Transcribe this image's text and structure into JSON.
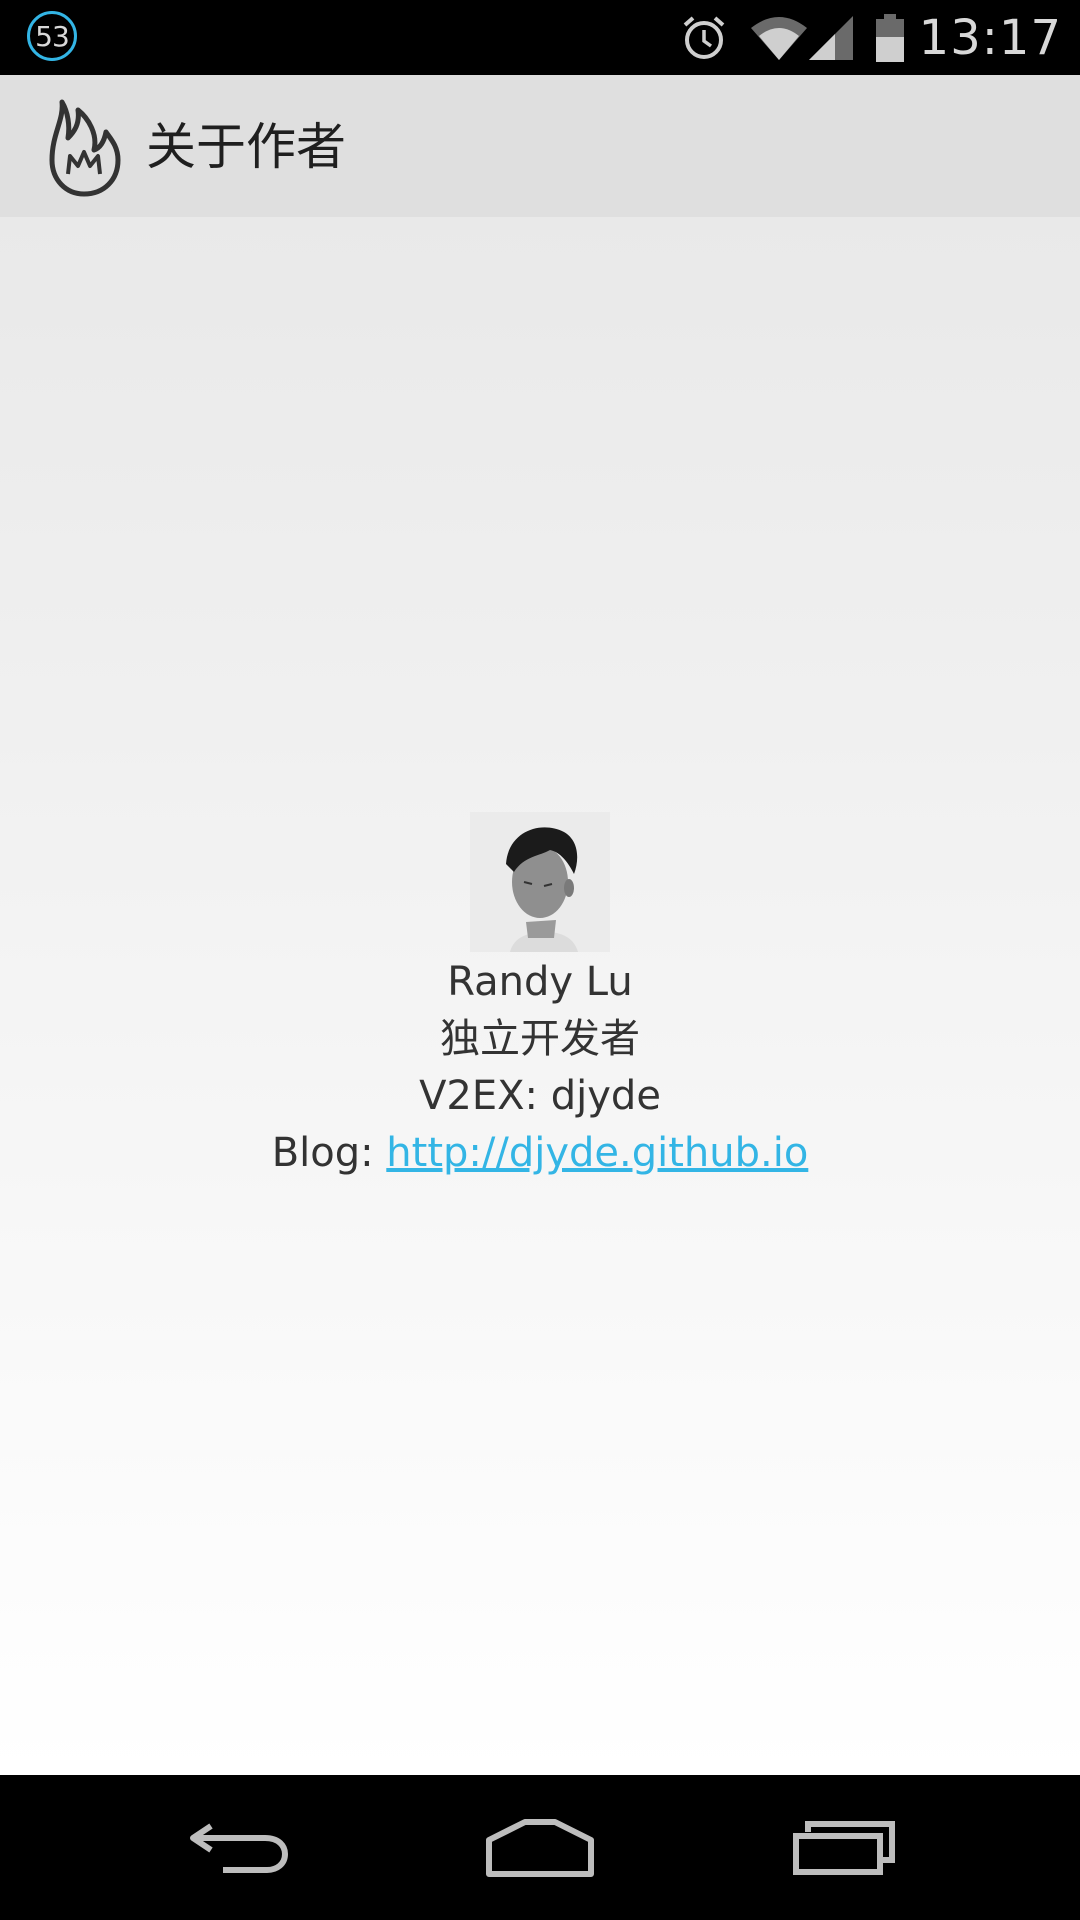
{
  "status_bar": {
    "notification_count": "53",
    "icons": [
      "alarm-icon",
      "wifi-icon",
      "signal-icon",
      "battery-icon"
    ],
    "time": "13:17"
  },
  "action_bar": {
    "logo_icon": "flame-icon",
    "title": "关于作者"
  },
  "profile": {
    "avatar_alt": "avatar",
    "name": "Randy Lu",
    "role": "独立开发者",
    "v2ex_prefix": "V2EX: ",
    "v2ex_user": "djyde",
    "blog_prefix": "Blog: ",
    "blog_url": "http://djyde.github.io"
  },
  "nav_bar": {
    "buttons": [
      "back-icon",
      "home-icon",
      "recent-apps-icon"
    ]
  },
  "colors": {
    "accent": "#33b5e5",
    "action_bar_bg": "#dfdfdf",
    "text": "#333333"
  }
}
